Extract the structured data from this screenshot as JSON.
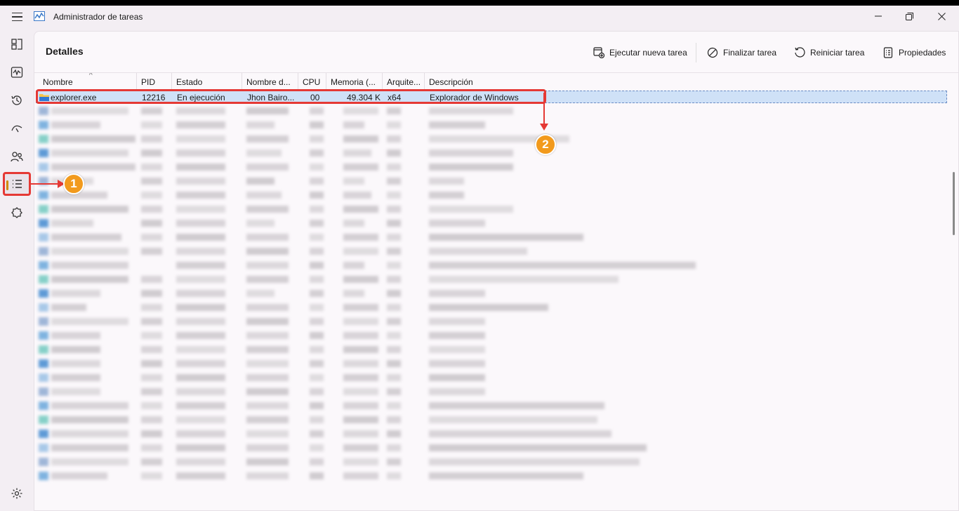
{
  "window": {
    "title": "Administrador de tareas",
    "controls": [
      "minimize-icon",
      "maximize-icon",
      "close-icon"
    ]
  },
  "nav": {
    "items": [
      {
        "name": "processes",
        "icon": "processes-icon"
      },
      {
        "name": "performance",
        "icon": "performance-icon"
      },
      {
        "name": "app-history",
        "icon": "history-icon"
      },
      {
        "name": "startup-apps",
        "icon": "startup-icon"
      },
      {
        "name": "users",
        "icon": "users-icon"
      },
      {
        "name": "details",
        "icon": "list-icon",
        "active": true
      },
      {
        "name": "services",
        "icon": "services-icon"
      }
    ],
    "settings_icon": "gear-icon"
  },
  "page": {
    "title": "Detalles",
    "commands": {
      "run_new_task": "Ejecutar nueva tarea",
      "end_task": "Finalizar tarea",
      "restart_task": "Reiniciar tarea",
      "properties": "Propiedades"
    }
  },
  "table": {
    "columns": [
      "Nombre",
      "PID",
      "Estado",
      "Nombre d...",
      "CPU",
      "Memoria (...",
      "Arquite...",
      "Descripción"
    ],
    "selected_row": {
      "name": "explorer.exe",
      "pid": "12216",
      "status": "En ejecución",
      "user": "Jhon Bairo...",
      "cpu": "00",
      "memory": "49.304 K",
      "arch": "x64",
      "description": "Explorador de Windows"
    }
  },
  "annotations": {
    "badge1": "1",
    "badge2": "2"
  },
  "colors": {
    "accent": "#d08b00",
    "highlight": "#e53935",
    "badge": "#f29a1d",
    "selection": "#cfe1f7"
  }
}
